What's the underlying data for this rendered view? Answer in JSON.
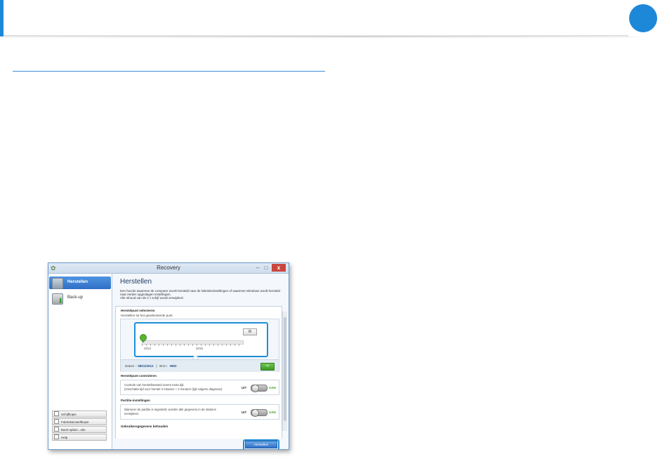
{
  "colors": {
    "accent": "#1e88d8",
    "highlight": "#1f8fd9",
    "go_green": "#4aab2f"
  },
  "window": {
    "title": "Recovery",
    "minimize": "–",
    "maximize": "□",
    "close": "x"
  },
  "sidebar": {
    "items": [
      {
        "label": "Herstellen",
        "icon": "restore-icon"
      },
      {
        "label": "Back-up",
        "icon": "backup-disk-icon"
      }
    ],
    "buttons": [
      "Schijfkopie",
      "Fabrieksinstellkopie",
      "Back-uplam...uits",
      "Help"
    ]
  },
  "main": {
    "title": "Herstellen",
    "intro_line1": "Een functie waarmee de computer wordt hersteld naar de fabrieksinstellingen of waarmee Windows wordt hersteld",
    "intro_line2": "naar eerder opgeslagen instellingen.",
    "intro_line3": "Alle inhoud van de C:\\ schijf wordt verwijderd.",
    "restore_point": {
      "title": "Herstelpunt selecteren",
      "subtitle": "Herstellen tot het geselecteerde punt.",
      "year_start": "2012",
      "year_end": "2015",
      "date_label": "Datum :",
      "date_value": "08/11/2012",
      "separator": "|",
      "source_label": "Bron :",
      "source_value": "HDD",
      "view_button": "⚙",
      "go_button": "⇨"
    },
    "check": {
      "title": "Herstelpunt controleren",
      "line1": "Controle van herstelbestand neemt extra tijd.",
      "line2": "(Geschatte tijd voor herstel 3 minuten + 2 minuten (tijd volgens diagnose)",
      "off": "UIT",
      "on": "AAN"
    },
    "partition": {
      "title": "Partitie-instellingen",
      "line1": "Wanneer de partitie is ingesteld, worden alle gegevens in de stations",
      "line2": "verwijderd.",
      "off": "UIT",
      "on": "AAN"
    },
    "userdata": {
      "title": "Gebruikersgegevens behouden"
    },
    "restore_button": "Herstellen"
  }
}
